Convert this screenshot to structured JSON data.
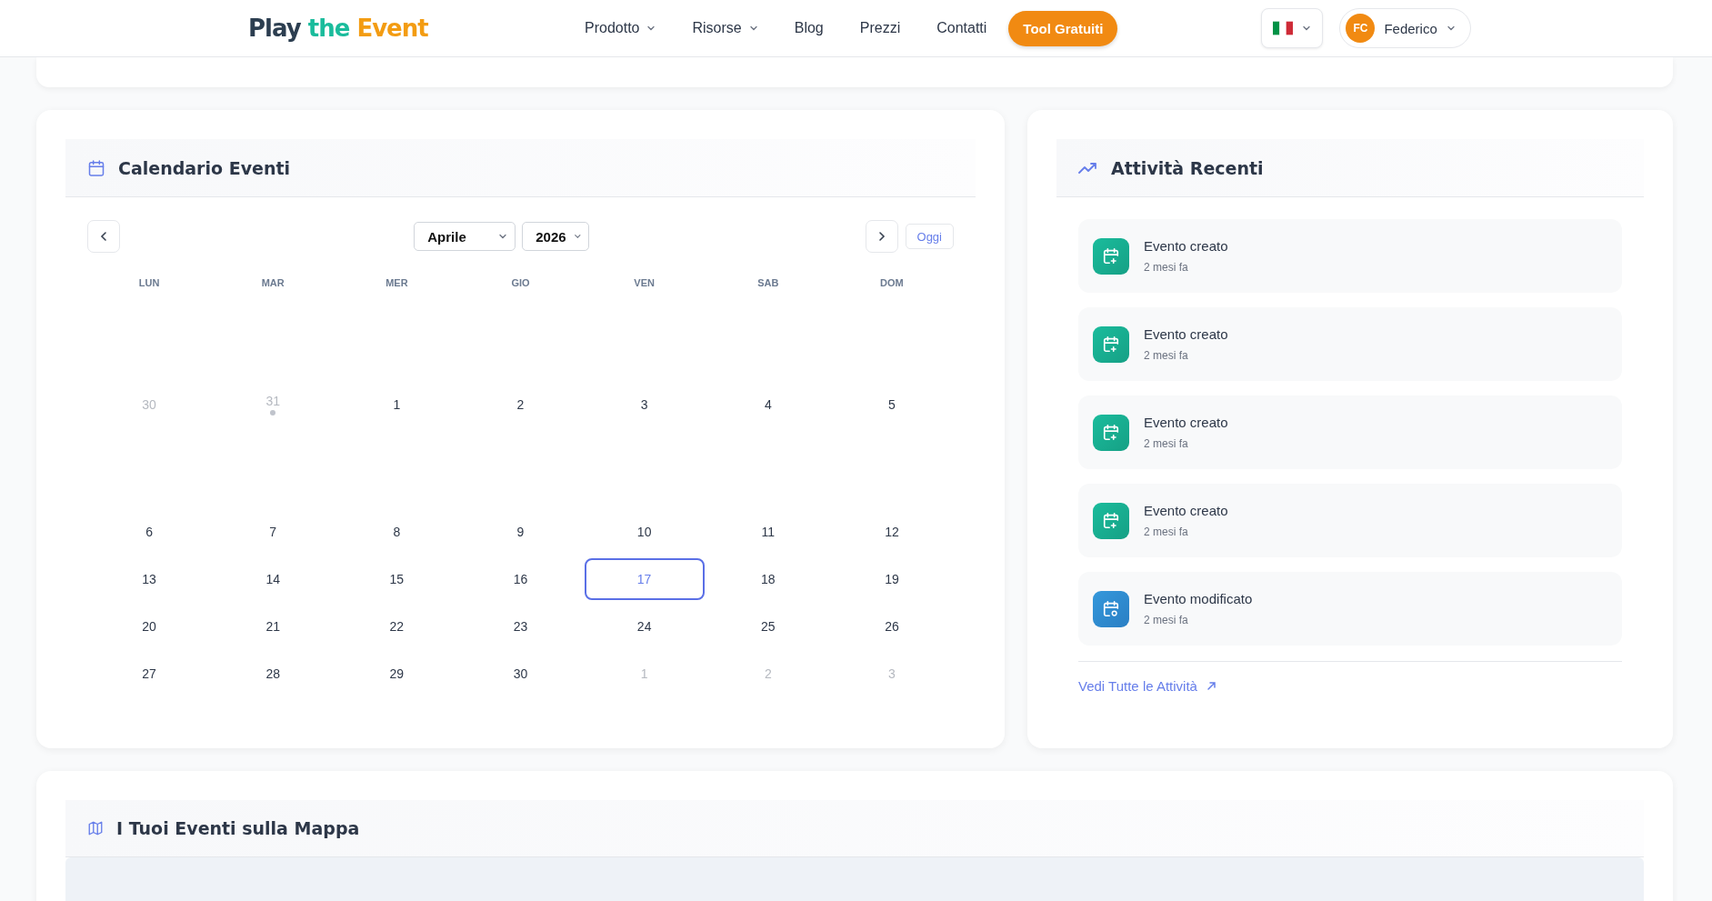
{
  "header": {
    "logo": [
      {
        "text": "Play",
        "color": "#2c3e50"
      },
      {
        "text": "the",
        "color": "#1abc9c"
      },
      {
        "text": "Event",
        "color": "#f39c12"
      }
    ],
    "nav": [
      {
        "label": "Prodotto",
        "dropdown": true
      },
      {
        "label": "Risorse",
        "dropdown": true
      },
      {
        "label": "Blog",
        "dropdown": false
      },
      {
        "label": "Prezzi",
        "dropdown": false
      },
      {
        "label": "Contatti",
        "dropdown": false
      }
    ],
    "cta": "Tool Gratuiti",
    "user": {
      "initials": "FC",
      "name": "Federico"
    }
  },
  "calendar": {
    "title": "Calendario Eventi",
    "month": "Aprile",
    "year": "2026",
    "today_button": "Oggi",
    "weekdays": [
      "LUN",
      "MAR",
      "MER",
      "GIO",
      "VEN",
      "SAB",
      "DOM"
    ],
    "weeks": [
      [
        {
          "day": "30",
          "outside": true,
          "selected": false,
          "event": false
        },
        {
          "day": "31",
          "outside": true,
          "selected": false,
          "event": true
        },
        {
          "day": "1",
          "outside": false,
          "selected": false,
          "event": false
        },
        {
          "day": "2",
          "outside": false,
          "selected": false,
          "event": false
        },
        {
          "day": "3",
          "outside": false,
          "selected": false,
          "event": false
        },
        {
          "day": "4",
          "outside": false,
          "selected": false,
          "event": false
        },
        {
          "day": "5",
          "outside": false,
          "selected": false,
          "event": false
        }
      ],
      [
        {
          "day": "6",
          "outside": false,
          "selected": false,
          "event": false
        },
        {
          "day": "7",
          "outside": false,
          "selected": false,
          "event": false
        },
        {
          "day": "8",
          "outside": false,
          "selected": false,
          "event": false
        },
        {
          "day": "9",
          "outside": false,
          "selected": false,
          "event": false
        },
        {
          "day": "10",
          "outside": false,
          "selected": false,
          "event": false
        },
        {
          "day": "11",
          "outside": false,
          "selected": false,
          "event": false
        },
        {
          "day": "12",
          "outside": false,
          "selected": false,
          "event": false
        }
      ],
      [
        {
          "day": "13",
          "outside": false,
          "selected": false,
          "event": false
        },
        {
          "day": "14",
          "outside": false,
          "selected": false,
          "event": false
        },
        {
          "day": "15",
          "outside": false,
          "selected": false,
          "event": false
        },
        {
          "day": "16",
          "outside": false,
          "selected": false,
          "event": false
        },
        {
          "day": "17",
          "outside": false,
          "selected": true,
          "event": false
        },
        {
          "day": "18",
          "outside": false,
          "selected": false,
          "event": false
        },
        {
          "day": "19",
          "outside": false,
          "selected": false,
          "event": false
        }
      ],
      [
        {
          "day": "20",
          "outside": false,
          "selected": false,
          "event": false
        },
        {
          "day": "21",
          "outside": false,
          "selected": false,
          "event": false
        },
        {
          "day": "22",
          "outside": false,
          "selected": false,
          "event": false
        },
        {
          "day": "23",
          "outside": false,
          "selected": false,
          "event": false
        },
        {
          "day": "24",
          "outside": false,
          "selected": false,
          "event": false
        },
        {
          "day": "25",
          "outside": false,
          "selected": false,
          "event": false
        },
        {
          "day": "26",
          "outside": false,
          "selected": false,
          "event": false
        }
      ],
      [
        {
          "day": "27",
          "outside": false,
          "selected": false,
          "event": false
        },
        {
          "day": "28",
          "outside": false,
          "selected": false,
          "event": false
        },
        {
          "day": "29",
          "outside": false,
          "selected": false,
          "event": false
        },
        {
          "day": "30",
          "outside": false,
          "selected": false,
          "event": false
        },
        {
          "day": "1",
          "outside": true,
          "selected": false,
          "event": false
        },
        {
          "day": "2",
          "outside": true,
          "selected": false,
          "event": false
        },
        {
          "day": "3",
          "outside": true,
          "selected": false,
          "event": false
        }
      ]
    ]
  },
  "activity": {
    "title": "Attività Recenti",
    "items": [
      {
        "kind": "created",
        "title": "Evento creato",
        "time": "2 mesi fa"
      },
      {
        "kind": "created",
        "title": "Evento creato",
        "time": "2 mesi fa"
      },
      {
        "kind": "created",
        "title": "Evento creato",
        "time": "2 mesi fa"
      },
      {
        "kind": "created",
        "title": "Evento creato",
        "time": "2 mesi fa"
      },
      {
        "kind": "modified",
        "title": "Evento modificato",
        "time": "2 mesi fa"
      }
    ],
    "link": "Vedi Tutte le Attività"
  },
  "map": {
    "title": "I Tuoi Eventi sulla Mappa"
  }
}
